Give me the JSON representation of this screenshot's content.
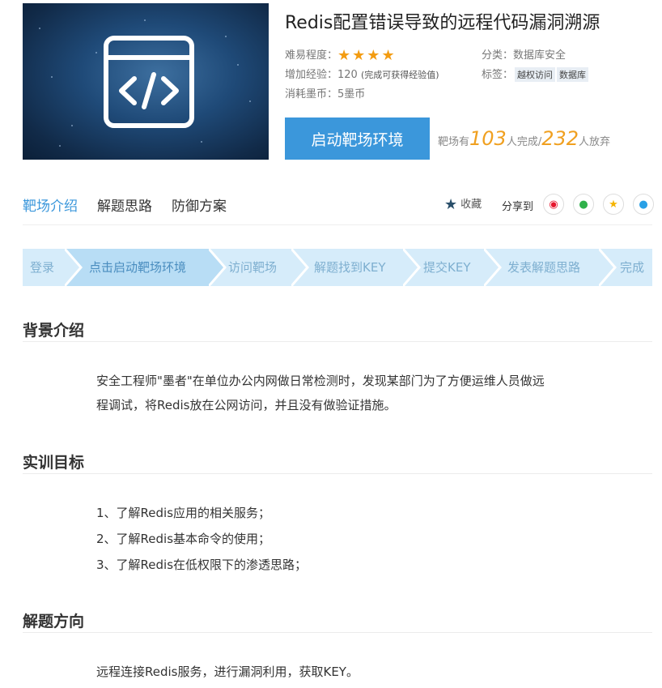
{
  "title": "Redis配置错误导致的远程代码漏洞溯源",
  "meta": {
    "difficulty_label": "难易程度：",
    "stars": 4,
    "exp_label": "增加经验：",
    "exp_value": "120",
    "exp_note": "(完成可获得经验值)",
    "coin_label": "消耗墨币：",
    "coin_value": "5墨币",
    "category_label": "分类：",
    "category_value": "数据库安全",
    "tags_label": "标签：",
    "tags": [
      "越权访问",
      "数据库"
    ]
  },
  "start_button": "启动靶场环境",
  "stats": {
    "prefix": "靶场有",
    "completed": "103",
    "completed_suffix": "人完成/",
    "abandoned": "232",
    "abandoned_suffix": "人放弃"
  },
  "tabs": [
    "靶场介绍",
    "解题思路",
    "防御方案"
  ],
  "favorite_label": "收藏",
  "share_label": "分享到",
  "share_icons": [
    "weibo-icon",
    "wechat-icon",
    "qzone-icon",
    "qq-icon"
  ],
  "steps": [
    "登录",
    "点击启动靶场环境",
    "访问靶场",
    "解题找到KEY",
    "提交KEY",
    "发表解题思路",
    "完成"
  ],
  "active_step": 1,
  "sections": {
    "background": {
      "title": "背景介绍",
      "lines": [
        "安全工程师\"墨者\"在单位办公内网做日常检测时，发现某部门为了方便运维人员做远",
        "程调试，将Redis放在公网访问，并且没有做验证措施。"
      ]
    },
    "goals": {
      "title": "实训目标",
      "items": [
        "1、了解Redis应用的相关服务；",
        "2、了解Redis基本命令的使用；",
        "3、了解Redis在低权限下的渗透思路；"
      ]
    },
    "direction": {
      "title": "解题方向",
      "text": "远程连接Redis服务，进行漏洞利用，获取KEY。"
    }
  },
  "colors": {
    "accent": "#3b97db",
    "star": "#f39c12",
    "stat_number": "#f0a020",
    "step_bar": "#d6ecfa"
  }
}
